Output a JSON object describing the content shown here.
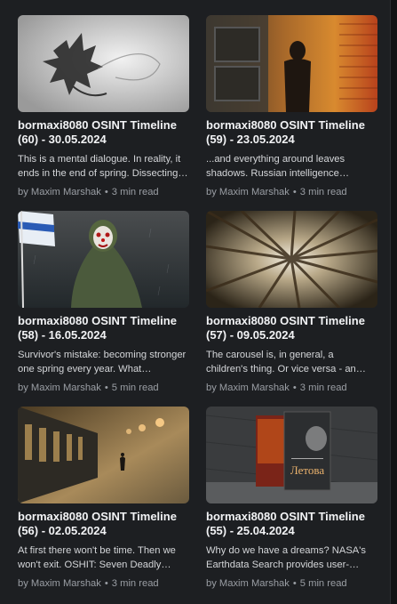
{
  "cards": [
    {
      "title": "bormaxi8080 OSINT Timeline (60) - 30.05.2024",
      "excerpt": "This is a mental dialogue. In reality, it ends in the end of spring. Dissecting the interview…",
      "author": "by Maxim Marshak",
      "separator": "•",
      "read_time": "3 min read",
      "image": "maple-leaf-falling"
    },
    {
      "title": "bormaxi8080 OSINT Timeline (59) - 23.05.2024",
      "excerpt": "...and everything around leaves shadows. Russian intelligence…",
      "author": "by Maxim Marshak",
      "separator": "•",
      "read_time": "3 min read",
      "image": "shadow-on-brick-wall"
    },
    {
      "title": "bormaxi8080 OSINT Timeline (58) - 16.05.2024",
      "excerpt": "Survivor's mistake: becoming stronger one spring every year. What…",
      "author": "by Maxim Marshak",
      "separator": "•",
      "read_time": "5 min read",
      "image": "clown-in-rain-with-flag"
    },
    {
      "title": "bormaxi8080 OSINT Timeline (57) - 09.05.2024",
      "excerpt": "The carousel is, in general, a children's thing. Or vice versa - an…",
      "author": "by Maxim Marshak",
      "separator": "•",
      "read_time": "3 min read",
      "image": "forest-canopy-from-below"
    },
    {
      "title": "bormaxi8080 OSINT Timeline (56) - 02.05.2024",
      "excerpt": "At first there won't be time. Then we won't exit. OSHIT: Seven Deadly Sins…",
      "author": "by Maxim Marshak",
      "separator": "•",
      "read_time": "3 min read",
      "image": "train-platform-fog"
    },
    {
      "title": "bormaxi8080 OSINT Timeline (55) - 25.04.2024",
      "excerpt": "Why do we have a dreams? NASA's Earthdata Search provides user-…",
      "author": "by Maxim Marshak",
      "separator": "•",
      "read_time": "5 min read",
      "image": "book-covers",
      "image_text": "Летова"
    }
  ]
}
